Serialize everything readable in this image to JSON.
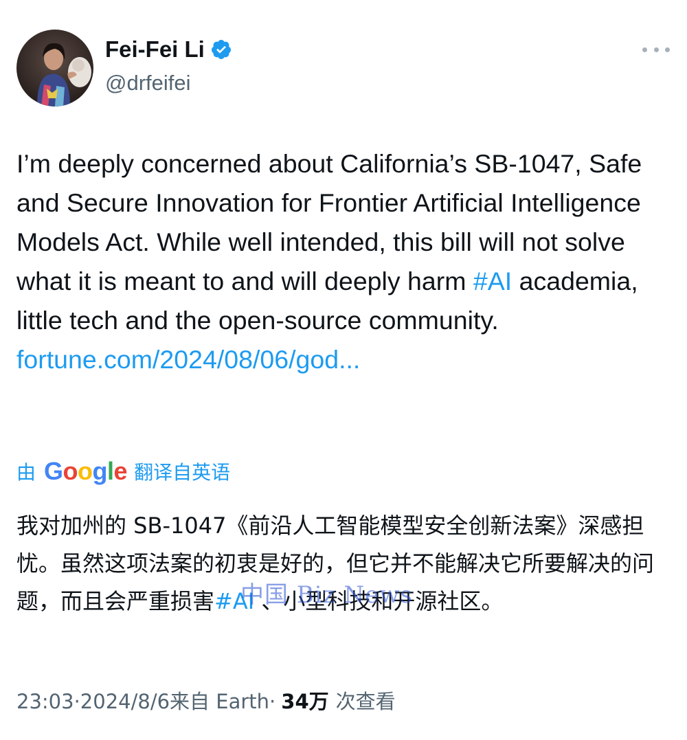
{
  "header": {
    "display_name": "Fei-Fei Li",
    "handle": "@drfeifei",
    "verified_color": "#1d9bf0",
    "avatar_icon": "avatar-photo",
    "more_icon": "more-horizontal-icon"
  },
  "tweet": {
    "segments": [
      "I’m deeply concerned about California’s SB-1047, Safe and Secure Innovation for Frontier Artificial Intelligence Models Act. While well intended, this bill will not solve what it is meant to and will deeply harm ",
      "#AI",
      " academia, little tech and the open-source community. ",
      "fortune.com/2024/08/06/god..."
    ]
  },
  "translation": {
    "prefix": "由",
    "brand": "Google",
    "suffix": "翻译自英语",
    "text_before_tag": "我对加州的 SB-1047《前沿人工智能模型安全创新法案》深感担忧。虽然这项法案的初衷是好的，但它并不能解决它所要解决的问题，而且会严重损害",
    "tag": "#AI",
    "text_after_tag": " 、小型科技和开源社区。",
    "watermark": "中国 Biz News"
  },
  "meta": {
    "time": "23:03",
    "sep1": " · ",
    "date": "2024/8/6",
    "source": " 来自 Earth",
    "sep2": " · ",
    "views": "34万",
    "views_label": "次查看"
  },
  "colors": {
    "link": "#1d9bf0",
    "secondary_text": "#536471",
    "primary_text": "#0f1419"
  }
}
